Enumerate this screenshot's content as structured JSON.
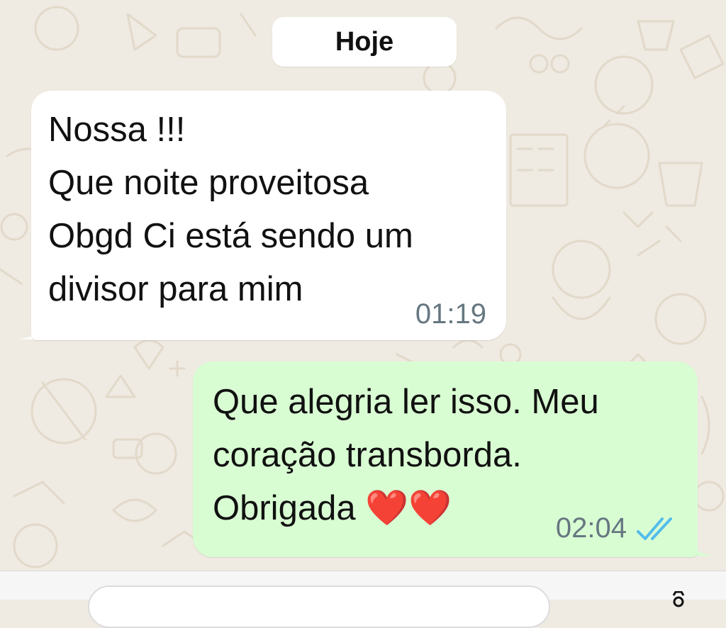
{
  "date_divider": {
    "label": "Hoje"
  },
  "incoming_message": {
    "lines": [
      "Nossa !!!",
      "Que noite proveitosa",
      "Obgd Ci está sendo um",
      "divisor para mim"
    ],
    "time": "01:19"
  },
  "outgoing_message": {
    "lines": [
      "Que alegria ler isso.  Meu",
      "coração transborda.",
      "Obrigada "
    ],
    "emoji": "❤️❤️",
    "time": "02:04",
    "status_icon": "double-check-read-icon"
  },
  "composer": {
    "input_value": "",
    "icons": [
      "camera-icon"
    ]
  },
  "colors": {
    "wallpaper": "#efeae2",
    "incoming_bubble": "#ffffff",
    "outgoing_bubble": "#d9fdd3",
    "timestamp": "#667781",
    "read_ticks": "#53bdeb"
  }
}
